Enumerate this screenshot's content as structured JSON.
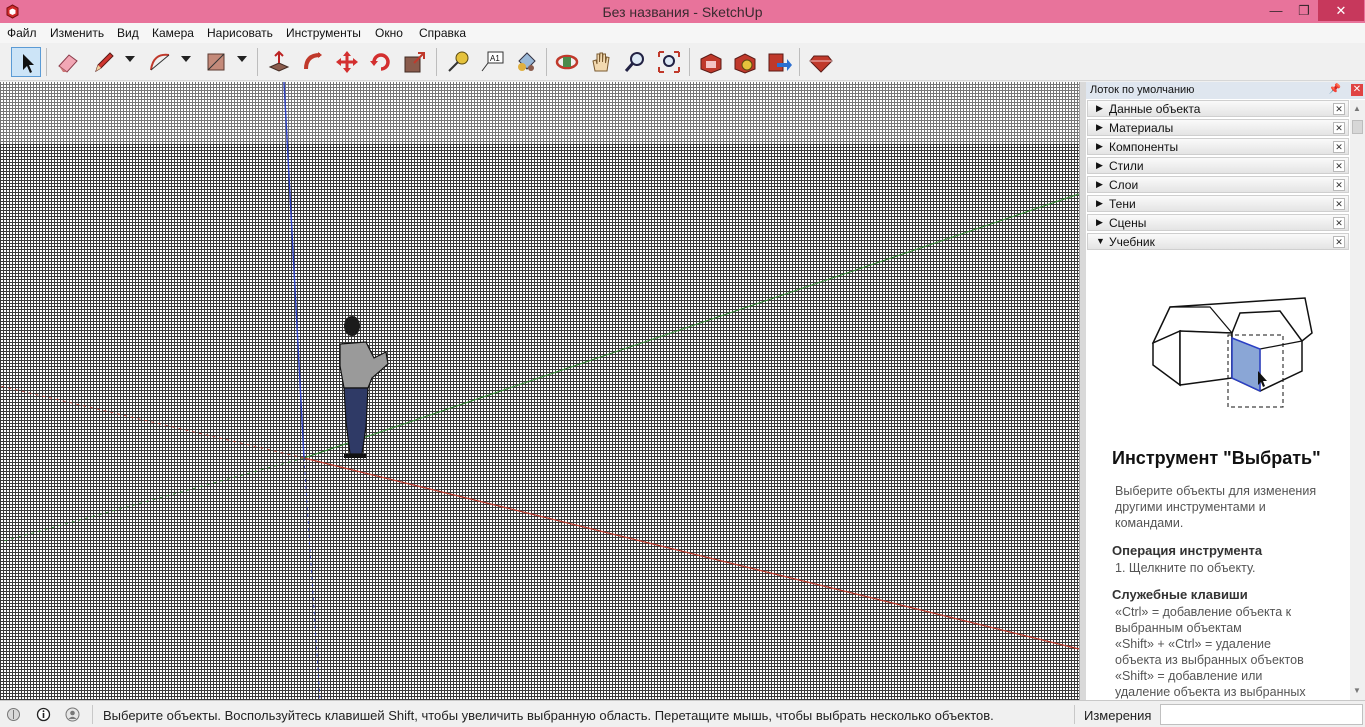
{
  "window": {
    "title": "Без названия - SketchUp"
  },
  "menu": [
    "Файл",
    "Изменить",
    "Вид",
    "Камера",
    "Нарисовать",
    "Инструменты",
    "Окно",
    "Справка"
  ],
  "tray": {
    "title": "Лоток по умолчанию",
    "panels": [
      {
        "label": "Данные объекта",
        "expanded": false
      },
      {
        "label": "Материалы",
        "expanded": false
      },
      {
        "label": "Компоненты",
        "expanded": false
      },
      {
        "label": "Стили",
        "expanded": false
      },
      {
        "label": "Слои",
        "expanded": false
      },
      {
        "label": "Тени",
        "expanded": false
      },
      {
        "label": "Сцены",
        "expanded": false
      },
      {
        "label": "Учебник",
        "expanded": true
      }
    ]
  },
  "tutorial": {
    "title": "Инструмент \"Выбрать\"",
    "description": "Выберите объекты для изменения другими инструментами и командами.",
    "operation_heading": "Операция инструмента",
    "operation_step": "1. Щелкните по объекту.",
    "keys_heading": "Служебные клавиши",
    "keys_lines": [
      "«Ctrl» = добавление объекта к",
      "выбранным объектам",
      "«Shift» + «Ctrl» = удаление",
      "объекта из выбранных объектов",
      "«Shift» = добавление или",
      "удаление объекта из выбранных"
    ]
  },
  "status": {
    "hint": "Выберите объекты. Воспользуйтесь клавишей Shift, чтобы увеличить выбранную область. Перетащите мышь, чтобы выбрать несколько объектов.",
    "measurements_label": "Измерения",
    "measurements_value": ""
  },
  "colors": {
    "titlebar": "#e8739b",
    "close": "#c7385c",
    "axis_red": "#c0392b",
    "axis_green": "#2e8b2e",
    "axis_blue": "#2b3fc4"
  }
}
